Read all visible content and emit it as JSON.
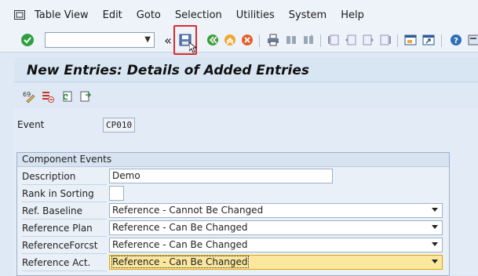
{
  "menu": [
    "Table View",
    "Edit",
    "Goto",
    "Selection",
    "Utilities",
    "System",
    "Help"
  ],
  "icons": {
    "enter": "check-circle-icon",
    "save": "save-icon",
    "back": "back-icon",
    "exit": "exit-icon",
    "cancel": "cancel-icon",
    "print": "print-icon",
    "find": "find-icon",
    "find_next": "find-next-icon",
    "first_page": "first-page-icon",
    "prev_page": "previous-page-icon",
    "next_page": "next-page-icon",
    "last_page": "last-page-icon",
    "new_session": "new-session-icon",
    "shortcut": "shortcut-icon",
    "help": "help-icon",
    "layout": "customize-layout-icon"
  },
  "colors": {
    "highlight": "#d82c2c",
    "focus_field": "#fbe79e",
    "enter_green": "#2ea043"
  },
  "title": "New Entries: Details of Added Entries",
  "app_toolbar": [
    "display-change-icon",
    "delete-icon",
    "undo-icon",
    "next-entry-icon"
  ],
  "event": {
    "label": "Event",
    "value": "CP010"
  },
  "group": {
    "title": "Component Events",
    "rows": [
      {
        "label": "Description",
        "value": "Demo"
      },
      {
        "label": "Rank in Sorting",
        "value": ""
      },
      {
        "label": "Ref. Baseline",
        "value": "Reference - Cannot Be Changed"
      },
      {
        "label": "Reference Plan",
        "value": "Reference - Can Be Changed"
      },
      {
        "label": "ReferenceForcst",
        "value": "Reference - Can Be Changed"
      },
      {
        "label": "Reference Act.",
        "value": "Reference - Can Be Changed"
      }
    ]
  }
}
